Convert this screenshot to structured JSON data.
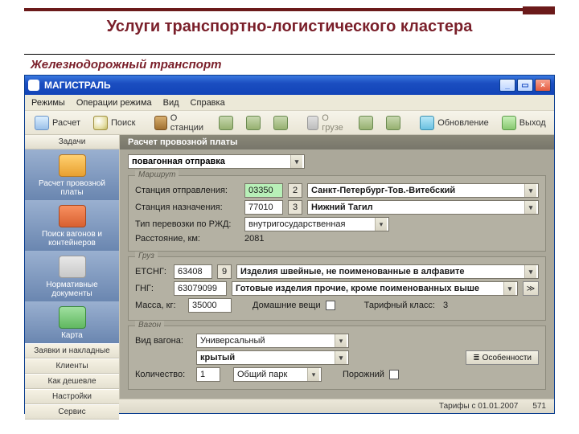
{
  "slide": {
    "title": "Услуги транспортно-логистического кластера",
    "subtitle": "Железнодорожный транспорт"
  },
  "window": {
    "title": "МАГИСТРАЛЬ",
    "menu": [
      "Режимы",
      "Операции режима",
      "Вид",
      "Справка"
    ],
    "toolbar": {
      "calc": "Расчет",
      "find": "Поиск",
      "station": "О станции",
      "gruz": "О грузе",
      "refresh": "Обновление",
      "exit": "Выход"
    }
  },
  "sidebar": {
    "header": "Задачи",
    "big": [
      {
        "label": "Расчет провозной платы"
      },
      {
        "label": "Поиск вагонов и контейнеров"
      },
      {
        "label": "Нормативные документы"
      },
      {
        "label": "Карта"
      }
    ],
    "items": [
      "Заявки и накладные",
      "Клиенты",
      "Как дешевле",
      "Настройки",
      "Сервис"
    ]
  },
  "pane": {
    "header": "Расчет провозной платы",
    "shipmentType": "повагонная отправка",
    "route": {
      "legend": "Маршрут",
      "depLabel": "Станция отправления:",
      "depCode": "03350",
      "depSub": "2",
      "depName": "Санкт-Петербург-Тов.-Витебский",
      "arrLabel": "Станция назначения:",
      "arrCode": "77010",
      "arrSub": "3",
      "arrName": "Нижний Тагил",
      "typeLabel": "Тип перевозки по РЖД:",
      "typeValue": "внутригосударственная",
      "distLabel": "Расстояние, км:",
      "distValue": "2081"
    },
    "cargo": {
      "legend": "Груз",
      "etsngLabel": "ЕТСНГ:",
      "etsngCode": "63408",
      "etsngSub": "9",
      "etsngName": "Изделия швейные, не поименованные в алфавите",
      "gngLabel": "ГНГ:",
      "gngCode": "63079099",
      "gngName": "Готовые изделия прочие, кроме поименованных выше",
      "massLabel": "Масса, кг:",
      "massValue": "35000",
      "homeLabel": "Домашние вещи",
      "classLabel": "Тарифный класс:",
      "classValue": "3"
    },
    "wagon": {
      "legend": "Вагон",
      "typeLabel": "Вид вагона:",
      "typeValue": "Универсальный",
      "subtype": "крытый",
      "qtyLabel": "Количество:",
      "qtyValue": "1",
      "park": "Общий парк",
      "emptyLabel": "Порожний",
      "featuresBtn": "Особенности"
    }
  },
  "status": {
    "tariff": "Тарифы  с 01.01.2007",
    "code": "571"
  }
}
